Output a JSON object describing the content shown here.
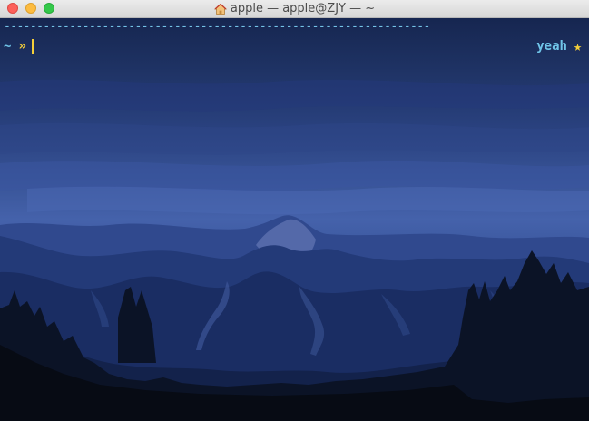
{
  "window": {
    "title": "apple — apple@ZJY — ~",
    "title_icon": "home-folder-icon",
    "buttons": [
      "close",
      "minimize",
      "zoom"
    ]
  },
  "terminal": {
    "separator": "-----------------------------------------------------------------",
    "prompt": {
      "directory": "~",
      "symbol": "»",
      "input": ""
    },
    "right_prompt": {
      "text": "yeah",
      "icon": "★"
    },
    "colors": {
      "prompt_dir": "#6fc4e8",
      "prompt_symbol": "#f4cf3a",
      "separator": "#74c3e6",
      "background_top": "#1b2c55",
      "background_bottom": "#070b12"
    },
    "background_image": "night-mountain-wallpaper"
  }
}
